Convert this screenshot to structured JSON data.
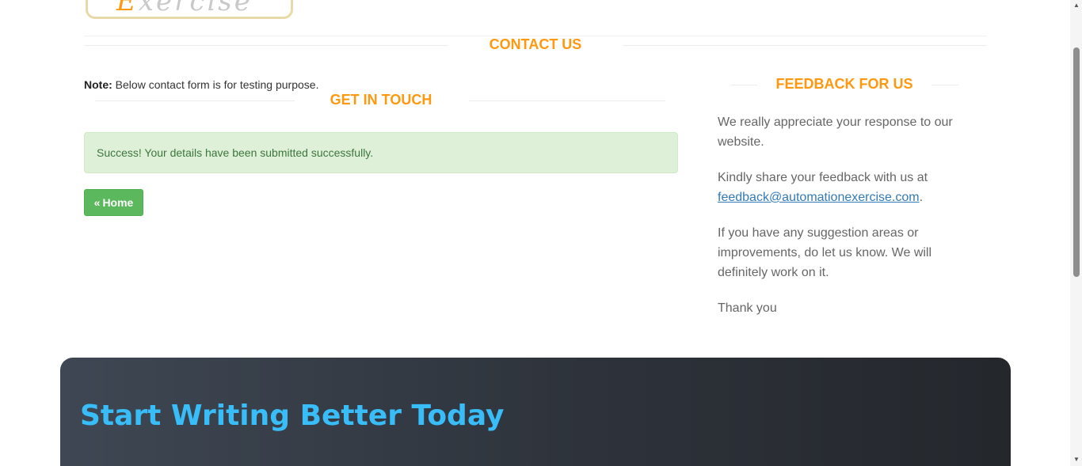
{
  "logo": {
    "first": "E",
    "rest": "xercise"
  },
  "contact": {
    "heading": "Contact Us"
  },
  "note": {
    "label": "Note:",
    "text": " Below contact form is for testing purpose."
  },
  "get_in_touch": {
    "heading": "Get In Touch"
  },
  "alert": {
    "message": "Success! Your details have been submitted successfully."
  },
  "home_button": {
    "label": "Home",
    "icon": "angle-double-left-icon",
    "color": "#5cb85c"
  },
  "feedback": {
    "heading": "Feedback For Us",
    "p1": "We really appreciate your response to our website.",
    "p2_prefix": "Kindly share your feedback with us at ",
    "p2_email": "feedback@automationexercise.com",
    "p2_suffix": ".",
    "p3": "If you have any suggestion areas or improvements, do let us know. We will definitely work on it.",
    "p4": "Thank you"
  },
  "banner": {
    "title": "Start Writing Better Today",
    "title_color": "#38bdf8"
  },
  "colors": {
    "accent": "#fe980f",
    "success_bg": "#dff0d8",
    "success_text": "#3c763d",
    "link": "#337ab7"
  }
}
